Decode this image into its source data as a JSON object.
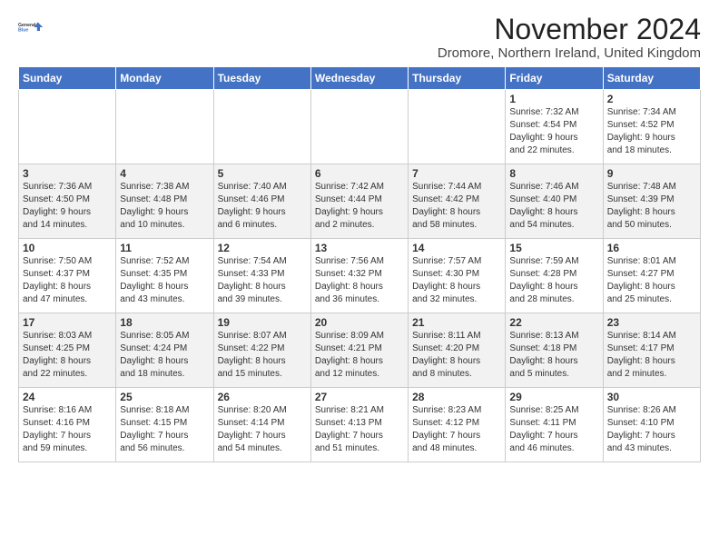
{
  "logo": {
    "line1": "General",
    "line2": "Blue"
  },
  "title": "November 2024",
  "subtitle": "Dromore, Northern Ireland, United Kingdom",
  "headers": [
    "Sunday",
    "Monday",
    "Tuesday",
    "Wednesday",
    "Thursday",
    "Friday",
    "Saturday"
  ],
  "weeks": [
    [
      {
        "day": "",
        "info": ""
      },
      {
        "day": "",
        "info": ""
      },
      {
        "day": "",
        "info": ""
      },
      {
        "day": "",
        "info": ""
      },
      {
        "day": "",
        "info": ""
      },
      {
        "day": "1",
        "info": "Sunrise: 7:32 AM\nSunset: 4:54 PM\nDaylight: 9 hours\nand 22 minutes."
      },
      {
        "day": "2",
        "info": "Sunrise: 7:34 AM\nSunset: 4:52 PM\nDaylight: 9 hours\nand 18 minutes."
      }
    ],
    [
      {
        "day": "3",
        "info": "Sunrise: 7:36 AM\nSunset: 4:50 PM\nDaylight: 9 hours\nand 14 minutes."
      },
      {
        "day": "4",
        "info": "Sunrise: 7:38 AM\nSunset: 4:48 PM\nDaylight: 9 hours\nand 10 minutes."
      },
      {
        "day": "5",
        "info": "Sunrise: 7:40 AM\nSunset: 4:46 PM\nDaylight: 9 hours\nand 6 minutes."
      },
      {
        "day": "6",
        "info": "Sunrise: 7:42 AM\nSunset: 4:44 PM\nDaylight: 9 hours\nand 2 minutes."
      },
      {
        "day": "7",
        "info": "Sunrise: 7:44 AM\nSunset: 4:42 PM\nDaylight: 8 hours\nand 58 minutes."
      },
      {
        "day": "8",
        "info": "Sunrise: 7:46 AM\nSunset: 4:40 PM\nDaylight: 8 hours\nand 54 minutes."
      },
      {
        "day": "9",
        "info": "Sunrise: 7:48 AM\nSunset: 4:39 PM\nDaylight: 8 hours\nand 50 minutes."
      }
    ],
    [
      {
        "day": "10",
        "info": "Sunrise: 7:50 AM\nSunset: 4:37 PM\nDaylight: 8 hours\nand 47 minutes."
      },
      {
        "day": "11",
        "info": "Sunrise: 7:52 AM\nSunset: 4:35 PM\nDaylight: 8 hours\nand 43 minutes."
      },
      {
        "day": "12",
        "info": "Sunrise: 7:54 AM\nSunset: 4:33 PM\nDaylight: 8 hours\nand 39 minutes."
      },
      {
        "day": "13",
        "info": "Sunrise: 7:56 AM\nSunset: 4:32 PM\nDaylight: 8 hours\nand 36 minutes."
      },
      {
        "day": "14",
        "info": "Sunrise: 7:57 AM\nSunset: 4:30 PM\nDaylight: 8 hours\nand 32 minutes."
      },
      {
        "day": "15",
        "info": "Sunrise: 7:59 AM\nSunset: 4:28 PM\nDaylight: 8 hours\nand 28 minutes."
      },
      {
        "day": "16",
        "info": "Sunrise: 8:01 AM\nSunset: 4:27 PM\nDaylight: 8 hours\nand 25 minutes."
      }
    ],
    [
      {
        "day": "17",
        "info": "Sunrise: 8:03 AM\nSunset: 4:25 PM\nDaylight: 8 hours\nand 22 minutes."
      },
      {
        "day": "18",
        "info": "Sunrise: 8:05 AM\nSunset: 4:24 PM\nDaylight: 8 hours\nand 18 minutes."
      },
      {
        "day": "19",
        "info": "Sunrise: 8:07 AM\nSunset: 4:22 PM\nDaylight: 8 hours\nand 15 minutes."
      },
      {
        "day": "20",
        "info": "Sunrise: 8:09 AM\nSunset: 4:21 PM\nDaylight: 8 hours\nand 12 minutes."
      },
      {
        "day": "21",
        "info": "Sunrise: 8:11 AM\nSunset: 4:20 PM\nDaylight: 8 hours\nand 8 minutes."
      },
      {
        "day": "22",
        "info": "Sunrise: 8:13 AM\nSunset: 4:18 PM\nDaylight: 8 hours\nand 5 minutes."
      },
      {
        "day": "23",
        "info": "Sunrise: 8:14 AM\nSunset: 4:17 PM\nDaylight: 8 hours\nand 2 minutes."
      }
    ],
    [
      {
        "day": "24",
        "info": "Sunrise: 8:16 AM\nSunset: 4:16 PM\nDaylight: 7 hours\nand 59 minutes."
      },
      {
        "day": "25",
        "info": "Sunrise: 8:18 AM\nSunset: 4:15 PM\nDaylight: 7 hours\nand 56 minutes."
      },
      {
        "day": "26",
        "info": "Sunrise: 8:20 AM\nSunset: 4:14 PM\nDaylight: 7 hours\nand 54 minutes."
      },
      {
        "day": "27",
        "info": "Sunrise: 8:21 AM\nSunset: 4:13 PM\nDaylight: 7 hours\nand 51 minutes."
      },
      {
        "day": "28",
        "info": "Sunrise: 8:23 AM\nSunset: 4:12 PM\nDaylight: 7 hours\nand 48 minutes."
      },
      {
        "day": "29",
        "info": "Sunrise: 8:25 AM\nSunset: 4:11 PM\nDaylight: 7 hours\nand 46 minutes."
      },
      {
        "day": "30",
        "info": "Sunrise: 8:26 AM\nSunset: 4:10 PM\nDaylight: 7 hours\nand 43 minutes."
      }
    ]
  ]
}
